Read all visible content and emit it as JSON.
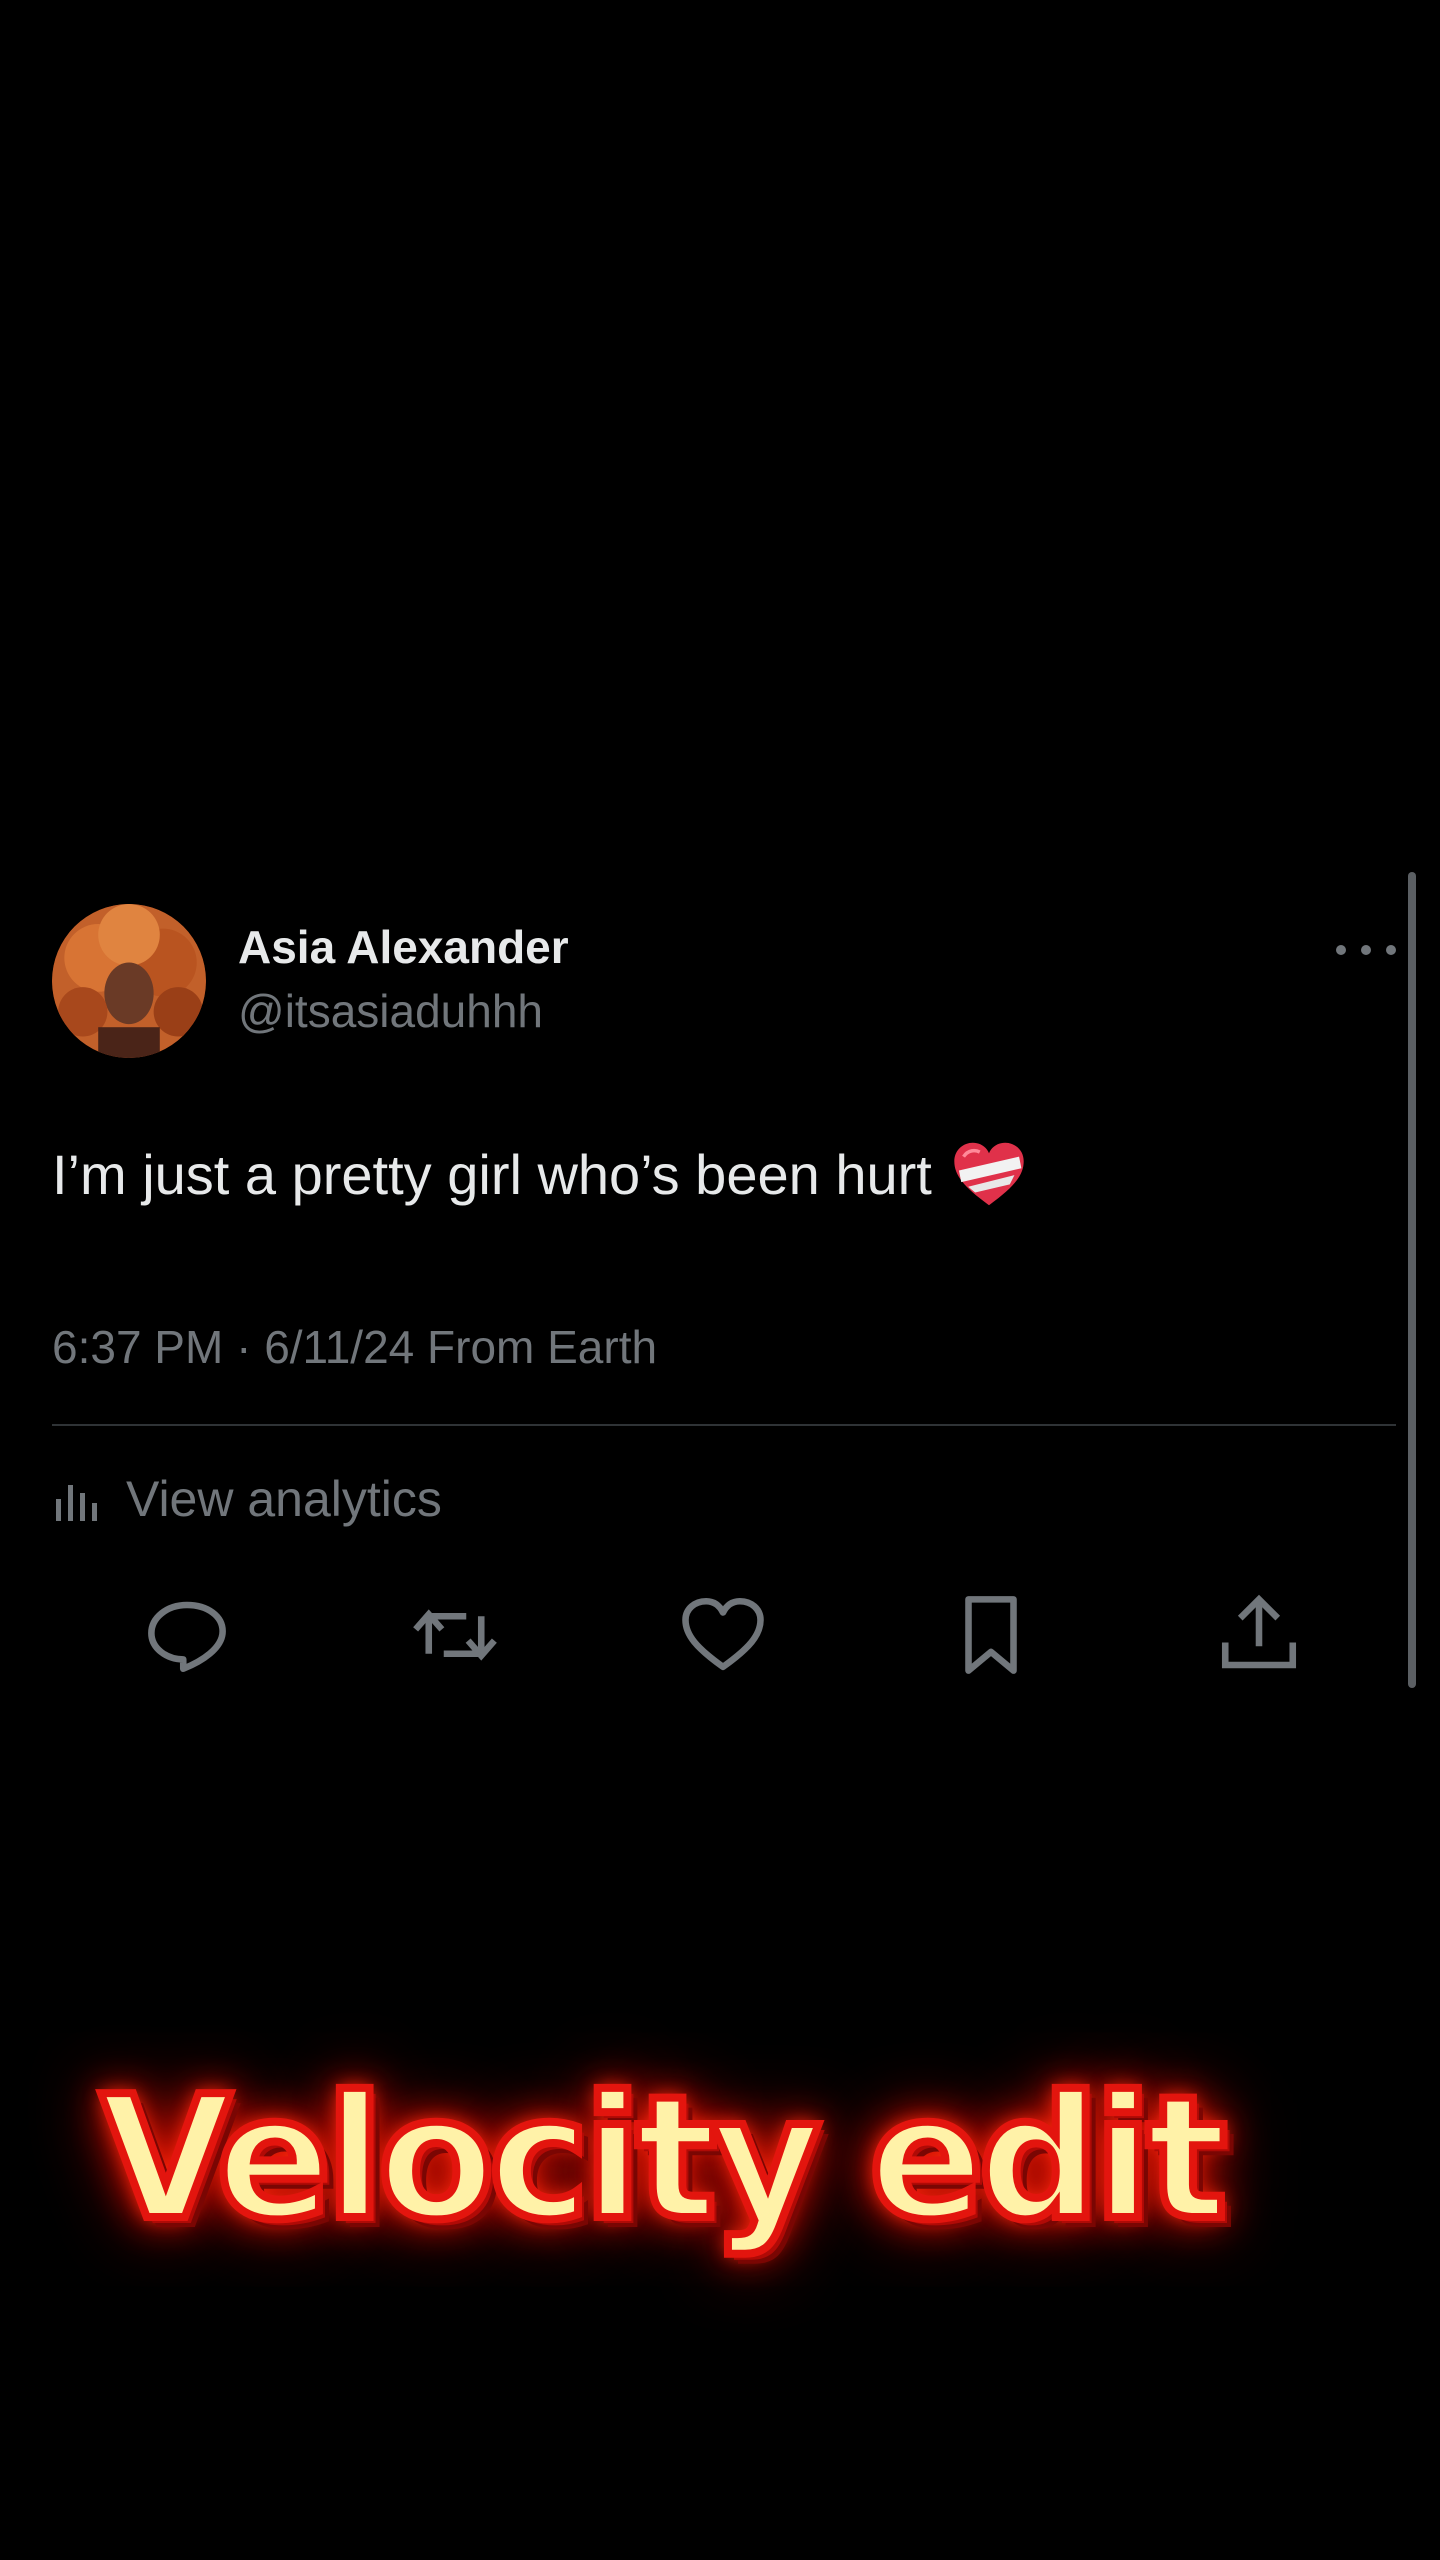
{
  "tweet": {
    "author_name": "Asia Alexander",
    "author_handle": "@itsasiaduhhh",
    "text": "I’m just a pretty girl who’s been hurt",
    "emoji": "mending-heart",
    "meta": "6:37 PM · 6/11/24 From Earth",
    "analytics_label": "View analytics"
  },
  "actions": [
    "reply",
    "repost",
    "like",
    "bookmark",
    "share"
  ],
  "watermark": {
    "text": "Velocity edit"
  },
  "colors": {
    "background": "#000000",
    "primary_text": "#e7e9ea",
    "secondary_text": "#71767b",
    "divider": "#2f3336",
    "watermark_fill": "#fff2a8",
    "watermark_stroke": "#e3150e"
  }
}
